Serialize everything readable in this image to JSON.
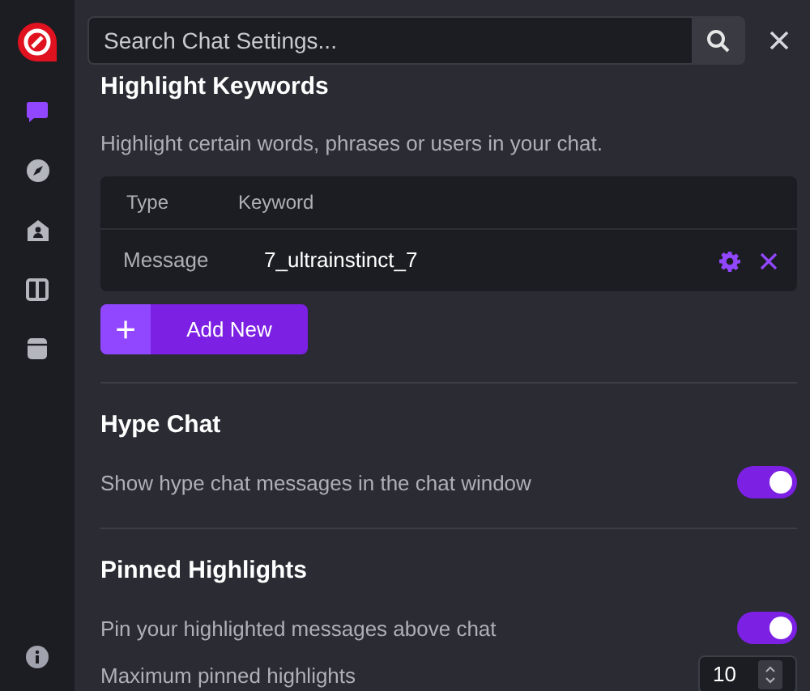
{
  "sidebar": {
    "items": [
      {
        "kind": "chat",
        "selected": true
      },
      {
        "kind": "compass",
        "selected": false
      },
      {
        "kind": "home",
        "selected": false
      },
      {
        "kind": "columns",
        "selected": false
      },
      {
        "kind": "archive",
        "selected": false
      }
    ]
  },
  "search": {
    "placeholder": "Search Chat Settings..."
  },
  "sections": [
    {
      "title": "Highlight Keywords",
      "description": "Highlight certain words, phrases or users in your chat.",
      "table": {
        "columns": [
          "Type",
          "Keyword"
        ],
        "rows": [
          {
            "type": "Message",
            "keyword": "7_ultrainstinct_7"
          }
        ]
      },
      "add_button": {
        "icon": "+",
        "label": "Add New"
      }
    },
    {
      "title": "Hype Chat",
      "settings": [
        {
          "kind": "toggle",
          "label": "Show hype chat messages in the chat window",
          "on": true
        }
      ]
    },
    {
      "title": "Pinned Highlights",
      "settings": [
        {
          "kind": "toggle",
          "label": "Pin your highlighted messages above chat",
          "on": true
        },
        {
          "kind": "number",
          "label": "Maximum pinned highlights",
          "value": "10"
        }
      ]
    }
  ]
}
